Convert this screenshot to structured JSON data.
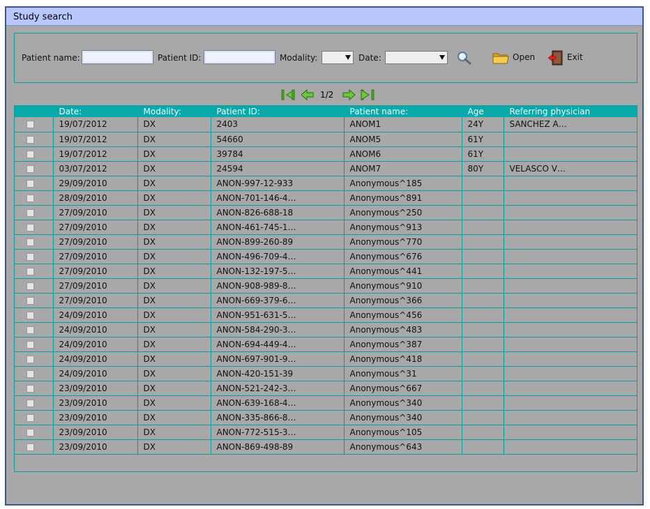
{
  "window": {
    "title": "Study search"
  },
  "search": {
    "patient_name_label": "Patient name:",
    "patient_name_value": "",
    "patient_id_label": "Patient ID:",
    "patient_id_value": "",
    "modality_label": "Modality:",
    "modality_value": "",
    "date_label": "Date:",
    "date_value": "",
    "search_icon": "magnifier-icon",
    "open_label": "Open",
    "open_icon": "folder-icon",
    "exit_label": "Exit",
    "exit_icon": "exit-door-icon"
  },
  "pager": {
    "info": "1/2",
    "icons": [
      "first-page-icon",
      "prev-page-icon",
      "next-page-icon",
      "last-page-icon"
    ]
  },
  "colors": {
    "title_bar": "#b8c8ff",
    "header": "#09a9a9",
    "background": "#a8a8a8",
    "grid": "#109a9a"
  },
  "table": {
    "columns": [
      "",
      "Date:",
      "Modality:",
      "Patient ID:",
      "Patient name:",
      "Age",
      "Referring physician"
    ],
    "rows": [
      [
        "19/07/2012",
        "DX",
        "2403",
        "ANOM1",
        "24Y",
        "SANCHEZ A…"
      ],
      [
        "19/07/2012",
        "DX",
        "54660",
        "ANOM5",
        "61Y",
        ""
      ],
      [
        "19/07/2012",
        "DX",
        "39784",
        "ANOM6",
        "61Y",
        ""
      ],
      [
        "03/07/2012",
        "DX",
        "24594",
        "ANOM7",
        "80Y",
        "VELASCO V…"
      ],
      [
        "29/09/2010",
        "DX",
        "ANON-997-12-933",
        "Anonymous^185",
        "",
        ""
      ],
      [
        "28/09/2010",
        "DX",
        "ANON-701-146-4…",
        "Anonymous^891",
        "",
        ""
      ],
      [
        "27/09/2010",
        "DX",
        "ANON-826-688-18",
        "Anonymous^250",
        "",
        ""
      ],
      [
        "27/09/2010",
        "DX",
        "ANON-461-745-1…",
        "Anonymous^913",
        "",
        ""
      ],
      [
        "27/09/2010",
        "DX",
        "ANON-899-260-89",
        "Anonymous^770",
        "",
        ""
      ],
      [
        "27/09/2010",
        "DX",
        "ANON-496-709-4…",
        "Anonymous^676",
        "",
        ""
      ],
      [
        "27/09/2010",
        "DX",
        "ANON-132-197-5…",
        "Anonymous^441",
        "",
        ""
      ],
      [
        "27/09/2010",
        "DX",
        "ANON-908-989-8…",
        "Anonymous^910",
        "",
        ""
      ],
      [
        "27/09/2010",
        "DX",
        "ANON-669-379-6…",
        "Anonymous^366",
        "",
        ""
      ],
      [
        "24/09/2010",
        "DX",
        "ANON-951-631-5…",
        "Anonymous^456",
        "",
        ""
      ],
      [
        "24/09/2010",
        "DX",
        "ANON-584-290-3…",
        "Anonymous^483",
        "",
        ""
      ],
      [
        "24/09/2010",
        "DX",
        "ANON-694-449-4…",
        "Anonymous^387",
        "",
        ""
      ],
      [
        "24/09/2010",
        "DX",
        "ANON-697-901-9…",
        "Anonymous^418",
        "",
        ""
      ],
      [
        "24/09/2010",
        "DX",
        "ANON-420-151-39",
        "Anonymous^31",
        "",
        ""
      ],
      [
        "23/09/2010",
        "DX",
        "ANON-521-242-3…",
        "Anonymous^667",
        "",
        ""
      ],
      [
        "23/09/2010",
        "DX",
        "ANON-639-168-4…",
        "Anonymous^340",
        "",
        ""
      ],
      [
        "23/09/2010",
        "DX",
        "ANON-335-866-8…",
        "Anonymous^340",
        "",
        ""
      ],
      [
        "23/09/2010",
        "DX",
        "ANON-772-515-3…",
        "Anonymous^105",
        "",
        ""
      ],
      [
        "23/09/2010",
        "DX",
        "ANON-869-498-89",
        "Anonymous^643",
        "",
        ""
      ]
    ]
  }
}
